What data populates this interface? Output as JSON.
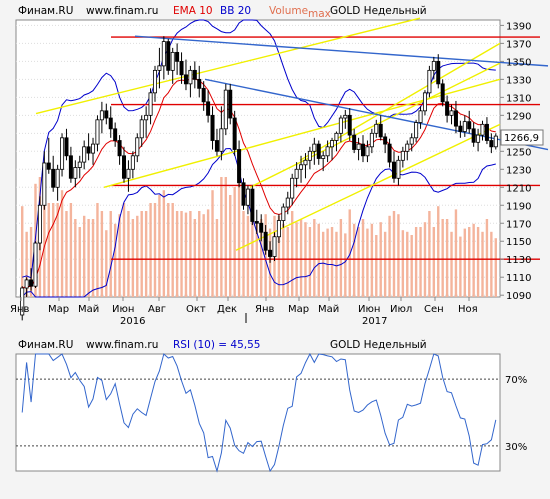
{
  "header_top": {
    "source": "Финам.RU",
    "site": "www.finam.ru",
    "ema": "EMA 10",
    "bb": "BB 20",
    "volume": "Volume",
    "max": "max",
    "instrument": "GOLD Недельный"
  },
  "header_bottom": {
    "source": "Финам.RU",
    "site": "www.finam.ru",
    "rsi": "RSI (10) = 45,55",
    "instrument": "GOLD Недельный"
  },
  "colors": {
    "background": "#F4F4F4",
    "plot_bg": "#FFFFFF",
    "up_candle": "#FFFFFF",
    "down_candle": "#000000",
    "ema": "#E00000",
    "bollinger": "#0000CC",
    "volume": "#F4B49C",
    "resistance": "#E00000",
    "channel": "#F0F000",
    "trend_blue": "#3366CC",
    "rsi": "#3366CC",
    "price_tag_bg": "#FFFFFF"
  },
  "chart_data": [
    {
      "type": "candlestick",
      "title": "GOLD Недельный",
      "y_axis": {
        "ticks": [
          1090,
          1110,
          1130,
          1150,
          1170,
          1190,
          1210,
          1230,
          1250,
          1270,
          1290,
          1310,
          1330,
          1350,
          1370,
          1390
        ],
        "ylim": [
          1088,
          1396
        ]
      },
      "x_axis": {
        "months": [
          "Янв",
          "Мар",
          "Май",
          "Июн",
          "Авг",
          "Окт",
          "Дек",
          "Янв",
          "Мар",
          "Май",
          "Июн",
          "Июл",
          "Сен",
          "Ноя"
        ],
        "years": [
          "2016",
          "2017"
        ]
      },
      "last_price": "1266,9",
      "horizontal_levels": [
        1377,
        1302,
        1212,
        1130
      ],
      "ohlc": [
        [
          1068,
          1100,
          1062,
          1098
        ],
        [
          1098,
          1110,
          1088,
          1107
        ],
        [
          1107,
          1120,
          1095,
          1100
        ],
        [
          1100,
          1150,
          1098,
          1148
        ],
        [
          1148,
          1200,
          1140,
          1190
        ],
        [
          1190,
          1250,
          1185,
          1237
        ],
        [
          1237,
          1265,
          1225,
          1230
        ],
        [
          1230,
          1245,
          1205,
          1210
        ],
        [
          1210,
          1235,
          1195,
          1230
        ],
        [
          1230,
          1270,
          1222,
          1265
        ],
        [
          1265,
          1275,
          1240,
          1245
        ],
        [
          1245,
          1255,
          1215,
          1220
        ],
        [
          1220,
          1240,
          1210,
          1232
        ],
        [
          1232,
          1245,
          1220,
          1238
        ],
        [
          1238,
          1262,
          1230,
          1255
        ],
        [
          1255,
          1270,
          1240,
          1248
        ],
        [
          1248,
          1265,
          1235,
          1258
        ],
        [
          1258,
          1290,
          1250,
          1285
        ],
        [
          1285,
          1305,
          1270,
          1295
        ],
        [
          1295,
          1303,
          1280,
          1287
        ],
        [
          1287,
          1300,
          1265,
          1275
        ],
        [
          1275,
          1282,
          1255,
          1262
        ],
        [
          1262,
          1268,
          1235,
          1245
        ],
        [
          1245,
          1255,
          1215,
          1220
        ],
        [
          1220,
          1240,
          1205,
          1230
        ],
        [
          1230,
          1250,
          1220,
          1245
        ],
        [
          1245,
          1270,
          1238,
          1265
        ],
        [
          1265,
          1290,
          1255,
          1285
        ],
        [
          1285,
          1300,
          1265,
          1290
        ],
        [
          1290,
          1320,
          1280,
          1315
        ],
        [
          1315,
          1345,
          1305,
          1340
        ],
        [
          1340,
          1365,
          1320,
          1345
        ],
        [
          1345,
          1378,
          1330,
          1372
        ],
        [
          1372,
          1375,
          1335,
          1340
        ],
        [
          1340,
          1365,
          1325,
          1360
        ],
        [
          1360,
          1370,
          1335,
          1350
        ],
        [
          1350,
          1360,
          1325,
          1335
        ],
        [
          1335,
          1352,
          1318,
          1325
        ],
        [
          1325,
          1345,
          1310,
          1340
        ],
        [
          1340,
          1350,
          1320,
          1330
        ],
        [
          1330,
          1345,
          1310,
          1320
        ],
        [
          1320,
          1328,
          1295,
          1305
        ],
        [
          1305,
          1318,
          1282,
          1290
        ],
        [
          1290,
          1300,
          1252,
          1262
        ],
        [
          1262,
          1275,
          1245,
          1250
        ],
        [
          1250,
          1300,
          1240,
          1275
        ],
        [
          1275,
          1325,
          1268,
          1318
        ],
        [
          1318,
          1325,
          1280,
          1287
        ],
        [
          1287,
          1295,
          1245,
          1252
        ],
        [
          1252,
          1262,
          1210,
          1215
        ],
        [
          1215,
          1220,
          1185,
          1190
        ],
        [
          1190,
          1212,
          1180,
          1208
        ],
        [
          1208,
          1212,
          1168,
          1172
        ],
        [
          1172,
          1185,
          1158,
          1170
        ],
        [
          1170,
          1180,
          1150,
          1160
        ],
        [
          1160,
          1168,
          1135,
          1140
        ],
        [
          1140,
          1150,
          1126,
          1133
        ],
        [
          1133,
          1160,
          1128,
          1155
        ],
        [
          1155,
          1180,
          1148,
          1173
        ],
        [
          1173,
          1192,
          1165,
          1188
        ],
        [
          1188,
          1205,
          1180,
          1198
        ],
        [
          1198,
          1225,
          1190,
          1220
        ],
        [
          1220,
          1238,
          1210,
          1230
        ],
        [
          1230,
          1245,
          1215,
          1235
        ],
        [
          1235,
          1248,
          1220,
          1240
        ],
        [
          1240,
          1255,
          1230,
          1250
        ],
        [
          1250,
          1265,
          1235,
          1258
        ],
        [
          1258,
          1262,
          1235,
          1242
        ],
        [
          1242,
          1250,
          1228,
          1245
        ],
        [
          1245,
          1262,
          1238,
          1255
        ],
        [
          1255,
          1265,
          1240,
          1262
        ],
        [
          1262,
          1272,
          1250,
          1270
        ],
        [
          1270,
          1290,
          1260,
          1287
        ],
        [
          1287,
          1296,
          1275,
          1290
        ],
        [
          1290,
          1298,
          1262,
          1268
        ],
        [
          1268,
          1275,
          1248,
          1252
        ],
        [
          1252,
          1265,
          1240,
          1258
        ],
        [
          1258,
          1268,
          1238,
          1245
        ],
        [
          1245,
          1262,
          1238,
          1255
        ],
        [
          1255,
          1275,
          1248,
          1270
        ],
        [
          1270,
          1285,
          1265,
          1280
        ],
        [
          1280,
          1290,
          1262,
          1266
        ],
        [
          1266,
          1270,
          1248,
          1258
        ],
        [
          1258,
          1264,
          1232,
          1238
        ],
        [
          1238,
          1250,
          1215,
          1220
        ],
        [
          1220,
          1245,
          1212,
          1240
        ],
        [
          1240,
          1255,
          1232,
          1250
        ],
        [
          1250,
          1262,
          1240,
          1258
        ],
        [
          1258,
          1270,
          1250,
          1265
        ],
        [
          1265,
          1285,
          1260,
          1282
        ],
        [
          1282,
          1300,
          1275,
          1295
        ],
        [
          1295,
          1318,
          1290,
          1315
        ],
        [
          1315,
          1345,
          1310,
          1340
        ],
        [
          1340,
          1355,
          1330,
          1350
        ],
        [
          1350,
          1358,
          1320,
          1325
        ],
        [
          1325,
          1330,
          1300,
          1305
        ],
        [
          1305,
          1312,
          1282,
          1290
        ],
        [
          1290,
          1302,
          1280,
          1295
        ],
        [
          1295,
          1306,
          1270,
          1278
        ],
        [
          1278,
          1284,
          1265,
          1272
        ],
        [
          1272,
          1290,
          1266,
          1283
        ],
        [
          1283,
          1295,
          1270,
          1275
        ],
        [
          1275,
          1282,
          1255,
          1260
        ],
        [
          1260,
          1275,
          1250,
          1268
        ],
        [
          1268,
          1284,
          1262,
          1280
        ],
        [
          1280,
          1288,
          1258,
          1262
        ],
        [
          1262,
          1270,
          1248,
          1255
        ],
        [
          1255,
          1270,
          1252,
          1266.9
        ]
      ]
    },
    {
      "type": "line",
      "title": "RSI (10)",
      "value": 45.55,
      "levels": [
        70,
        30
      ],
      "level_labels": [
        "70%",
        "30%"
      ],
      "ylim": [
        15,
        85
      ]
    }
  ]
}
